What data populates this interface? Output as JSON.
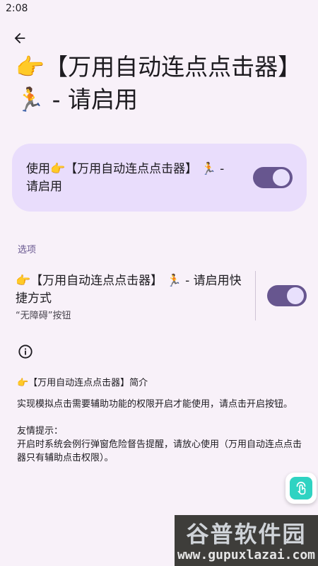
{
  "status_bar": {
    "time": "2:08"
  },
  "header": {
    "back_icon": "arrow-left-icon",
    "title": "👉【万用自动连点点击器】 🏃 - 请启用"
  },
  "main_switch": {
    "label": "使用👉【万用自动连点点击器】 🏃 - 请启用",
    "checked": true
  },
  "options": {
    "section_label": "选项",
    "shortcut": {
      "title": "👉【万用自动连点点击器】 🏃 - 请启用快捷方式",
      "subtitle": "“无障碍”按钮",
      "checked": true
    }
  },
  "intro": {
    "icon": "info-icon",
    "title": "👉【万用自动连点点击器】简介",
    "body": " 实现模拟点击需要辅助功能的权限开启才能使用，请点击开启按钮。\n\n友情提示：\n 开启时系统会例行弹窗危险督告提醒，请放心使用（万用自动连点点击器只有辅助点击权限）。"
  },
  "fab": {
    "icon": "accessibility-touch-icon"
  },
  "watermark": {
    "title": "谷普软件园",
    "url": "www.gupuxlazai.com"
  },
  "colors": {
    "accent": "#67568f",
    "card": "#e9ddfc",
    "background": "#f8f1f9"
  }
}
